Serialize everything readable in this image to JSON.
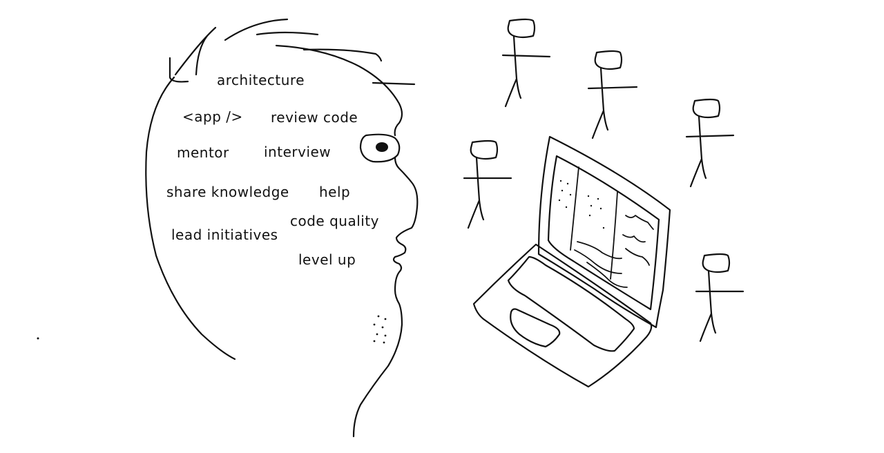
{
  "ink_color": "#111111",
  "background_color": "#ffffff",
  "head_words": {
    "architecture": "architecture",
    "app_tag": "<app />",
    "review_code": "review code",
    "mentor": "mentor",
    "interview": "interview",
    "share_knowledge": "share knowledge",
    "help": "help",
    "code_quality": "code quality",
    "lead_initiatives": "lead initiatives",
    "level_up": "level up"
  },
  "people_count": 5
}
